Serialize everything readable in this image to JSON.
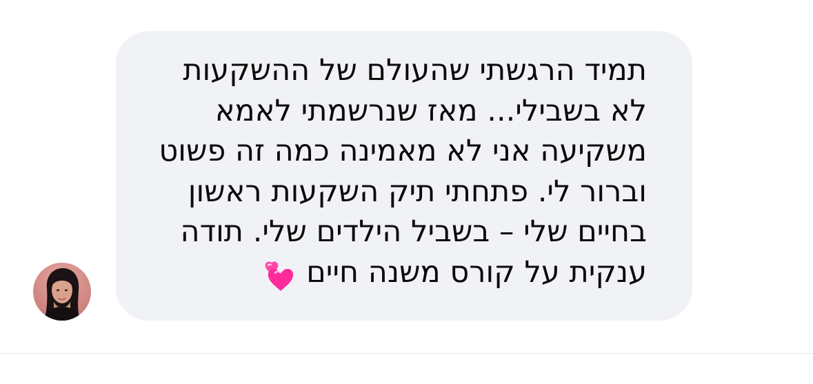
{
  "message": {
    "lines": [
      "תמיד הרגשתי שהעולם של ההשקעות",
      "לא בשבילי... מאז שנרשמתי לאמא",
      "משקיעה אני לא מאמינה כמה זה פשוט",
      "וברור לי. פתחתי תיק השקעות ראשון",
      "בחיים שלי – בשביל הילדים שלי. תודה",
      "ענקית על קורס משנה חיים"
    ],
    "emoji": "two-hearts-icon"
  },
  "colors": {
    "bubble": "#f1f2f5",
    "text": "#0b0b0b",
    "heart": "#ff3fa8"
  }
}
